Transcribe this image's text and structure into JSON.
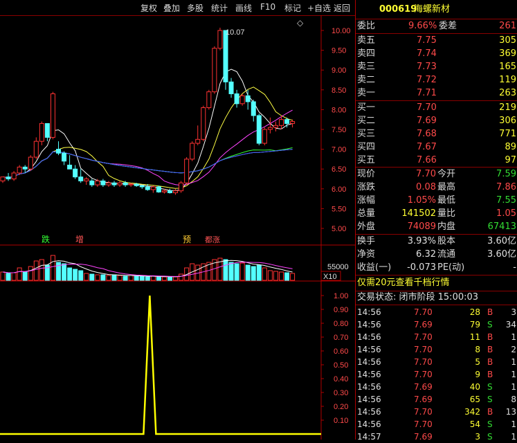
{
  "toolbar": {
    "buttons": [
      "复权",
      "叠加",
      "多股",
      "统计",
      "画线",
      "F10",
      "标记",
      "+自选",
      "返回"
    ]
  },
  "chart": {
    "markers": [
      {
        "label": "跌",
        "color": "#33ff33"
      },
      {
        "label": "增",
        "color": "#ff5555"
      },
      {
        "label": "预",
        "color": "#ffcc33"
      },
      {
        "label": "都涨",
        "color": "#ff5555"
      }
    ],
    "peak_label": "10.07",
    "diamond_icon": "◇",
    "volume_label": "55000",
    "volume_unit": "X10"
  },
  "chart_data": [
    {
      "type": "candlestick",
      "y_ticks": [
        "10.00",
        "9.50",
        "9.00",
        "8.50",
        "8.00",
        "7.50",
        "7.00",
        "6.50",
        "6.00",
        "5.50",
        "5.00"
      ],
      "ylim": [
        5.0,
        10.0
      ],
      "ohlc": [
        [
          6.2,
          6.3,
          6.15,
          6.3
        ],
        [
          6.3,
          6.4,
          6.2,
          6.25
        ],
        [
          6.25,
          6.45,
          6.2,
          6.4
        ],
        [
          6.4,
          6.6,
          6.35,
          6.55
        ],
        [
          6.55,
          6.6,
          6.4,
          6.5
        ],
        [
          6.5,
          6.85,
          6.45,
          6.8
        ],
        [
          6.8,
          7.3,
          6.75,
          7.2
        ],
        [
          7.2,
          7.7,
          7.1,
          7.65
        ],
        [
          7.65,
          7.65,
          7.2,
          7.3
        ],
        [
          7.3,
          8.45,
          7.25,
          8.4
        ],
        [
          7.0,
          7.2,
          6.85,
          6.9
        ],
        [
          6.9,
          6.95,
          6.6,
          6.7
        ],
        [
          6.6,
          6.85,
          6.5,
          6.5
        ],
        [
          6.5,
          6.6,
          6.25,
          6.3
        ],
        [
          6.3,
          6.5,
          6.15,
          6.2
        ],
        [
          6.2,
          6.3,
          6.1,
          6.25
        ],
        [
          6.2,
          6.25,
          6.05,
          6.1
        ],
        [
          6.1,
          6.25,
          6.05,
          6.2
        ],
        [
          6.2,
          6.25,
          6.05,
          6.1
        ],
        [
          6.1,
          6.2,
          6.05,
          6.15
        ],
        [
          6.15,
          6.2,
          6.05,
          6.1
        ],
        [
          6.1,
          6.2,
          6.05,
          6.15
        ],
        [
          6.15,
          6.2,
          6.05,
          6.1
        ],
        [
          6.1,
          6.15,
          6.05,
          6.12
        ],
        [
          6.12,
          6.15,
          6.05,
          6.08
        ],
        [
          6.08,
          6.1,
          6.0,
          6.05
        ],
        [
          6.05,
          6.12,
          5.95,
          5.98
        ],
        [
          5.98,
          6.08,
          5.9,
          6.05
        ],
        [
          6.05,
          6.08,
          5.9,
          5.92
        ],
        [
          5.92,
          6.0,
          5.88,
          5.95
        ],
        [
          5.95,
          6.0,
          5.88,
          5.9
        ],
        [
          5.9,
          6.0,
          5.85,
          5.95
        ],
        [
          5.95,
          6.2,
          5.9,
          6.15
        ],
        [
          6.15,
          6.8,
          6.1,
          6.75
        ],
        [
          6.75,
          7.2,
          6.7,
          7.15
        ],
        [
          7.15,
          7.6,
          7.1,
          7.25
        ],
        [
          7.25,
          8.1,
          7.2,
          8.05
        ],
        [
          8.05,
          8.5,
          8.0,
          8.45
        ],
        [
          8.45,
          9.6,
          8.4,
          9.55
        ],
        [
          9.55,
          10.07,
          9.5,
          10.0
        ],
        [
          10.0,
          10.0,
          8.5,
          8.7
        ],
        [
          8.7,
          8.8,
          8.3,
          8.4
        ],
        [
          8.4,
          8.5,
          8.05,
          8.15
        ],
        [
          8.15,
          8.4,
          8.1,
          8.35
        ],
        [
          8.35,
          8.5,
          8.0,
          8.2
        ],
        [
          8.2,
          8.25,
          7.7,
          7.85
        ],
        [
          7.85,
          7.9,
          7.1,
          7.15
        ],
        [
          7.15,
          7.55,
          7.1,
          7.5
        ],
        [
          7.5,
          7.8,
          7.4,
          7.55
        ],
        [
          7.55,
          7.7,
          7.45,
          7.6
        ],
        [
          7.6,
          7.85,
          7.5,
          7.75
        ],
        [
          7.75,
          7.8,
          7.55,
          7.65
        ],
        [
          7.65,
          7.75,
          7.55,
          7.7
        ]
      ]
    },
    {
      "type": "bar",
      "volume": [
        12,
        10,
        11,
        18,
        12,
        20,
        28,
        30,
        22,
        36,
        26,
        24,
        18,
        16,
        14,
        10,
        9,
        8,
        8,
        7,
        8,
        7,
        6,
        7,
        6,
        6,
        5,
        6,
        5,
        5,
        5,
        5,
        9,
        18,
        24,
        22,
        24,
        26,
        30,
        32,
        30,
        26,
        24,
        25,
        22,
        20,
        22,
        18,
        14,
        13,
        12,
        11,
        10
      ]
    },
    {
      "type": "line",
      "ylim": [
        0,
        1.0
      ],
      "y_ticks": [
        "1.00",
        "0.90",
        "0.80",
        "0.70",
        "0.60",
        "0.50",
        "0.40",
        "0.30",
        "0.20",
        "0.10"
      ],
      "spike_position": 0.512,
      "spike_value": 1.0
    }
  ],
  "quote": {
    "code": "000619",
    "name": "海螺新材",
    "weibi_label": "委比",
    "weibi_value": "9.66%",
    "weicha_label": "委差",
    "weicha_value": "261",
    "sells": [
      {
        "label": "卖五",
        "price": "7.75",
        "vol": "305"
      },
      {
        "label": "卖四",
        "price": "7.74",
        "vol": "369"
      },
      {
        "label": "卖三",
        "price": "7.73",
        "vol": "165"
      },
      {
        "label": "卖二",
        "price": "7.72",
        "vol": "119"
      },
      {
        "label": "卖一",
        "price": "7.71",
        "vol": "263"
      }
    ],
    "buys": [
      {
        "label": "买一",
        "price": "7.70",
        "vol": "219"
      },
      {
        "label": "买二",
        "price": "7.69",
        "vol": "306"
      },
      {
        "label": "买三",
        "price": "7.68",
        "vol": "771"
      },
      {
        "label": "买四",
        "price": "7.67",
        "vol": "89"
      },
      {
        "label": "买五",
        "price": "7.66",
        "vol": "97"
      }
    ],
    "stats": [
      {
        "l1": "现价",
        "v1": "7.70",
        "c1": "red",
        "l2": "今开",
        "v2": "7.59",
        "c2": "grn"
      },
      {
        "l1": "涨跌",
        "v1": "0.08",
        "c1": "red",
        "l2": "最高",
        "v2": "7.86",
        "c2": "red"
      },
      {
        "l1": "涨幅",
        "v1": "1.05%",
        "c1": "red",
        "l2": "最低",
        "v2": "7.55",
        "c2": "grn"
      },
      {
        "l1": "总量",
        "v1": "141502",
        "c1": "yel",
        "l2": "量比",
        "v2": "1.05",
        "c2": "red"
      },
      {
        "l1": "外盘",
        "v1": "74089",
        "c1": "red",
        "l2": "内盘",
        "v2": "67413",
        "c2": "grn"
      }
    ],
    "stats2": [
      {
        "l1": "换手",
        "v1": "3.93%",
        "l2": "股本",
        "v2": "3.60亿"
      },
      {
        "l1": "净资",
        "v1": "6.32",
        "l2": "流通",
        "v2": "3.60亿"
      },
      {
        "l1": "收益(一)",
        "v1": "-0.073",
        "l2": "PE(动)",
        "v2": "-"
      }
    ],
    "promo": "仅需20元查看千档行情",
    "trade_status": "交易状态: 闭市阶段 15:00:03",
    "ticks": [
      {
        "time": "14:56",
        "price": "7.70",
        "vol": "28",
        "side": "B",
        "n": "3"
      },
      {
        "time": "14:56",
        "price": "7.69",
        "vol": "79",
        "side": "S",
        "n": "34"
      },
      {
        "time": "14:56",
        "price": "7.70",
        "vol": "11",
        "side": "B",
        "n": "1"
      },
      {
        "time": "14:56",
        "price": "7.70",
        "vol": "8",
        "side": "B",
        "n": "2"
      },
      {
        "time": "14:56",
        "price": "7.70",
        "vol": "5",
        "side": "B",
        "n": "1"
      },
      {
        "time": "14:56",
        "price": "7.70",
        "vol": "9",
        "side": "B",
        "n": "1"
      },
      {
        "time": "14:56",
        "price": "7.69",
        "vol": "40",
        "side": "S",
        "n": "1"
      },
      {
        "time": "14:56",
        "price": "7.69",
        "vol": "65",
        "side": "S",
        "n": "8"
      },
      {
        "time": "14:56",
        "price": "7.70",
        "vol": "342",
        "side": "B",
        "n": "13"
      },
      {
        "time": "14:56",
        "price": "7.70",
        "vol": "54",
        "side": "S",
        "n": "1"
      },
      {
        "time": "14:57",
        "price": "7.69",
        "vol": "3",
        "side": "S",
        "n": "1"
      }
    ]
  }
}
